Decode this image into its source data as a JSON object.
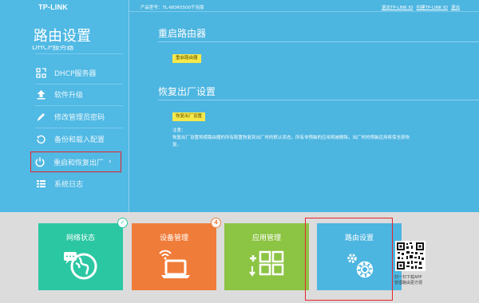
{
  "brand": {
    "logo": "TP-LINK"
  },
  "header": {
    "model_text": "产品型号：TL-WDR5500千兆版",
    "links": [
      "退出TP-LINK ID",
      "创建TP-LINK ID",
      "退出"
    ]
  },
  "sidebar": {
    "title": "路由设置",
    "cut_item": "DHCP服务器",
    "items": [
      {
        "label": "DHCP服务器",
        "icon": "dhcp-icon"
      },
      {
        "label": "软件升级",
        "icon": "upload-icon"
      },
      {
        "label": "修改管理员密码",
        "icon": "pencil-icon"
      },
      {
        "label": "备份和载入配置",
        "icon": "backup-icon"
      },
      {
        "label": "重启和恢复出厂",
        "icon": "power-icon",
        "chevron": "›"
      },
      {
        "label": "系统日志",
        "icon": "list-icon"
      }
    ]
  },
  "main": {
    "reboot": {
      "heading": "重启路由器",
      "button": "重启路由器"
    },
    "reset": {
      "heading": "恢复出厂设置",
      "button": "恢复出厂设置",
      "note_title": "注意：",
      "note_text": "恢复出厂设置将使路由器的所有配置恢复到出厂时的默认状态，所有非预装的应用将被删除，出厂时的预装应用将保全部恢复。"
    }
  },
  "dock": {
    "tiles": [
      {
        "label": "网络状态",
        "badge": "✓",
        "color": "#2bc7a3",
        "icon": "globe-icon"
      },
      {
        "label": "设备管理",
        "badge": "4",
        "color": "#f07c3a",
        "icon": "laptop-icon"
      },
      {
        "label": "应用管理",
        "badge": "",
        "color": "#8cc444",
        "icon": "apps-icon"
      },
      {
        "label": "路由设置",
        "badge": "",
        "color": "#4cb5e0",
        "icon": "gear-icon"
      }
    ],
    "qr_caption": "扫一扫下载APP管理路由更方便"
  }
}
